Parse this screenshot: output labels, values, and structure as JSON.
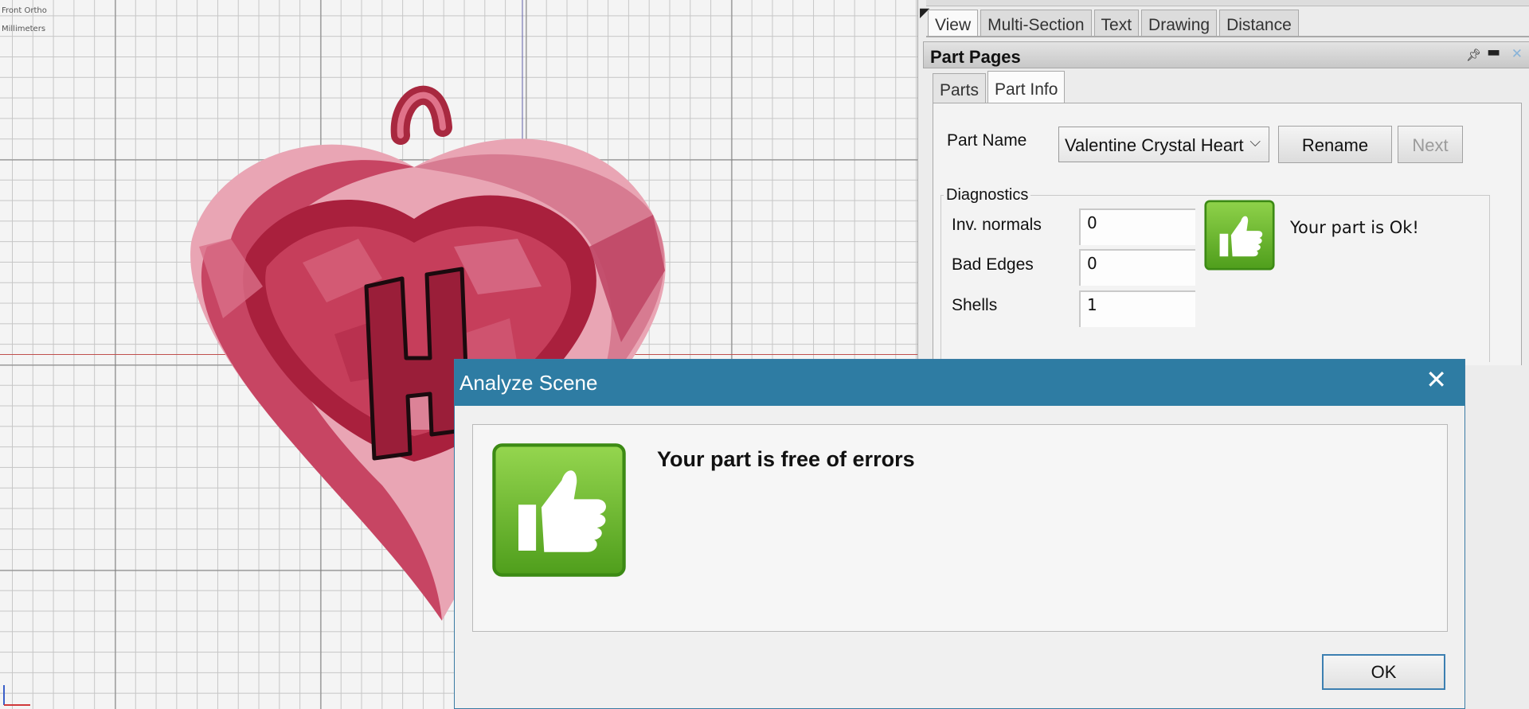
{
  "viewport": {
    "view_label": "Front Ortho",
    "units_label": "Millimeters"
  },
  "top_tabs": [
    "View",
    "Multi-Section",
    "Text",
    "Drawing",
    "Distance"
  ],
  "part_pages": {
    "title": "Part Pages",
    "pin_icon": "pin-icon",
    "minimize_icon": "minimize-icon",
    "close_icon": "close-icon",
    "tabs": [
      "Parts",
      "Part Info"
    ],
    "active_tab": "Part Info",
    "part_name_label": "Part Name",
    "part_name_value": "Valentine Crystal Heart",
    "rename_label": "Rename",
    "next_label": "Next",
    "diagnostics": {
      "title": "Diagnostics",
      "inv_normals_label": "Inv. normals",
      "inv_normals_value": "0",
      "bad_edges_label": "Bad Edges",
      "bad_edges_value": "0",
      "shells_label": "Shells",
      "shells_value": "1",
      "status_text": "Your part is Ok!",
      "status_icon": "thumbs-up-icon"
    }
  },
  "dialog": {
    "title": "Analyze Scene",
    "close_glyph": "✕",
    "message": "Your part is free of errors",
    "icon": "thumbs-up-icon",
    "ok_label": "OK"
  },
  "colors": {
    "dialog_titlebar": "#2e7ca3",
    "thumb_green": "#6cbd2a",
    "heart_red": "#b8334f"
  }
}
